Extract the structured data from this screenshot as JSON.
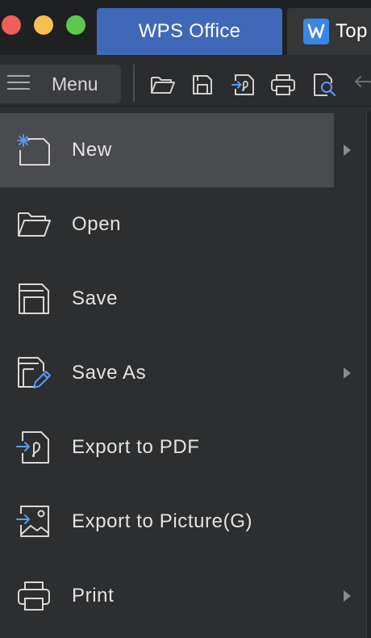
{
  "window": {
    "tabs": [
      {
        "label": "WPS Office",
        "active": true
      },
      {
        "label": "Top",
        "active": false,
        "icon": "word-doc-icon"
      }
    ]
  },
  "toolbar": {
    "menu_label": "Menu",
    "icons": [
      "open-folder-icon",
      "save-icon",
      "export-pdf-icon",
      "print-icon",
      "print-preview-icon",
      "undo-icon"
    ]
  },
  "menu": {
    "items": [
      {
        "label": "New",
        "icon": "new-document-icon",
        "has_submenu": true,
        "highlighted": true
      },
      {
        "label": "Open",
        "icon": "open-folder-icon",
        "has_submenu": false
      },
      {
        "label": "Save",
        "icon": "save-icon",
        "has_submenu": false
      },
      {
        "label": "Save As",
        "icon": "save-as-icon",
        "has_submenu": true
      },
      {
        "label": "Export to PDF",
        "icon": "export-pdf-icon",
        "has_submenu": false
      },
      {
        "label": "Export to Picture(G)",
        "icon": "export-picture-icon",
        "has_submenu": false
      },
      {
        "label": "Print",
        "icon": "print-icon",
        "has_submenu": true
      }
    ]
  },
  "colors": {
    "background": "#2d2e30",
    "titlebar": "#1f2022",
    "active_tab": "#3f68b8",
    "accent_blue": "#5b9bf0",
    "text": "#e4e4e4",
    "highlight": "#4a4b4e"
  }
}
